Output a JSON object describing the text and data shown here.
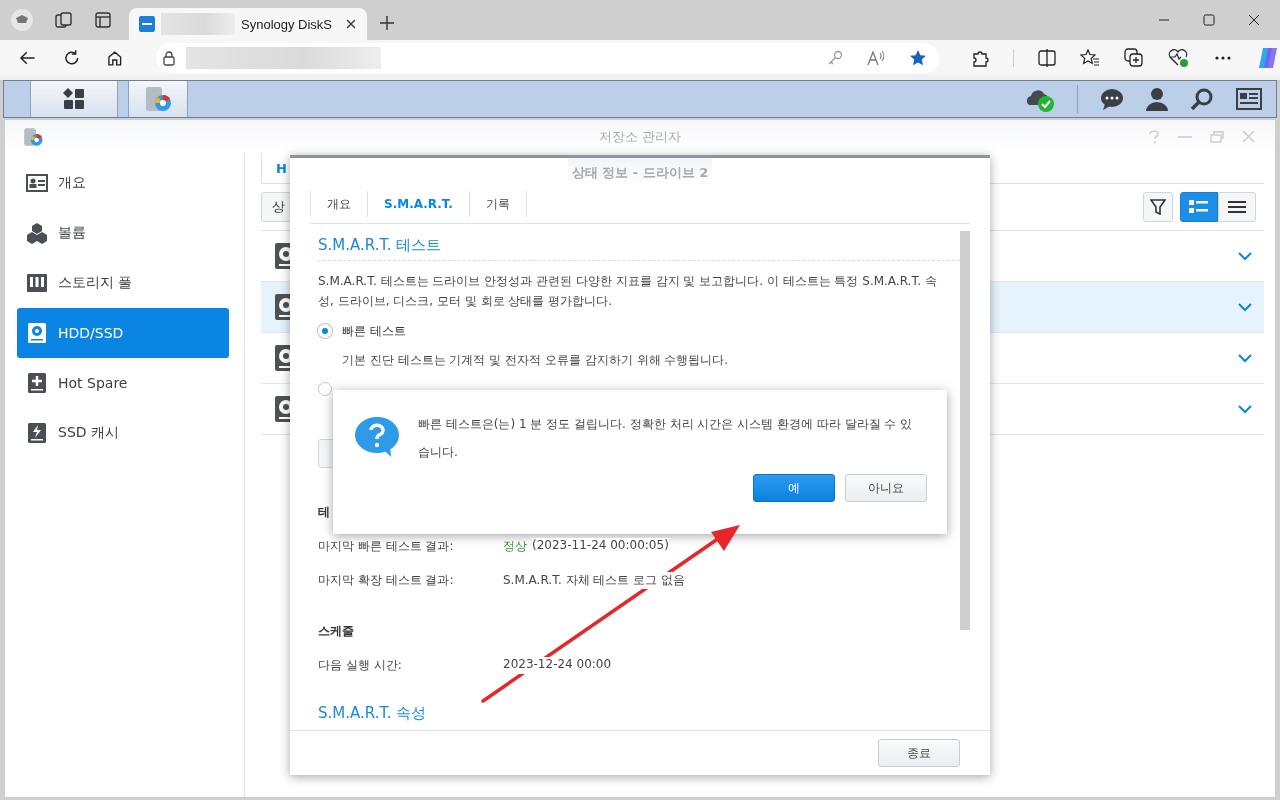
{
  "browser": {
    "tab": {
      "title": "Synology DiskS"
    }
  },
  "storage_manager": {
    "title": "저장소 관리자",
    "sidebar": {
      "items": [
        {
          "label": "개요",
          "selected": false
        },
        {
          "label": "볼륨",
          "selected": false
        },
        {
          "label": "스토리지 풀",
          "selected": false
        },
        {
          "label": "HDD/SSD",
          "selected": true
        },
        {
          "label": "Hot Spare",
          "selected": false
        },
        {
          "label": "SSD 캐시",
          "selected": false
        }
      ]
    },
    "header_tab": {
      "label": "H"
    },
    "toolbar_button": {
      "label": "상"
    },
    "view_toggle": [
      {
        "kind": "detail",
        "selected": true
      },
      {
        "kind": "list",
        "selected": false
      }
    ],
    "drives": [
      {
        "selected": false
      },
      {
        "selected": true
      },
      {
        "selected": false
      },
      {
        "selected": false
      }
    ]
  },
  "status_dialog": {
    "title": "상태 정보 - 드라이브 2",
    "tabs": [
      {
        "label": "개요",
        "selected": false
      },
      {
        "label": "S.M.A.R.T.",
        "selected": true
      },
      {
        "label": "기록",
        "selected": false
      }
    ],
    "section_title": "S.M.A.R.T. 테스트",
    "description": "S.M.A.R.T. 테스트는 드라이브 안정성과 관련된 다양한 지표를 감지 및 보고합니다. 이 테스트는 특정 S.M.A.R.T. 속성, 드라이브, 디스크, 모터 및 회로 상태를 평가합니다.",
    "options": [
      {
        "label": "빠른 테스트",
        "selected": true,
        "description": "기본 진단 테스트는 기계적 및 전자적 오류를 감지하기 위해 수행됩니다."
      },
      {
        "selected": false
      }
    ],
    "results_heading": "테",
    "results": [
      {
        "label": "마지막 빠른 테스트 결과:",
        "status": "정상",
        "value": "(2023-11-24 00:00:05)"
      },
      {
        "label": "마지막 확장 테스트 결과:",
        "value": "S.M.A.R.T. 자체 테스트 로그 없음"
      }
    ],
    "schedule_heading": "스케줄",
    "schedule": [
      {
        "label": "다음 실행 시간:",
        "value": "2023-12-24 00:00"
      }
    ],
    "attributes_title": "S.M.A.R.T. 속성",
    "close_button": "종료"
  },
  "confirm": {
    "message": "빠른 테스트은(는) 1 분 정도 걸립니다. 정확한 처리 시간은 시스템 환경에 따라 달라질 수 있습니다.",
    "buttons": [
      {
        "label": "예",
        "kind": "primary"
      },
      {
        "label": "아니요",
        "kind": "secondary"
      }
    ]
  }
}
